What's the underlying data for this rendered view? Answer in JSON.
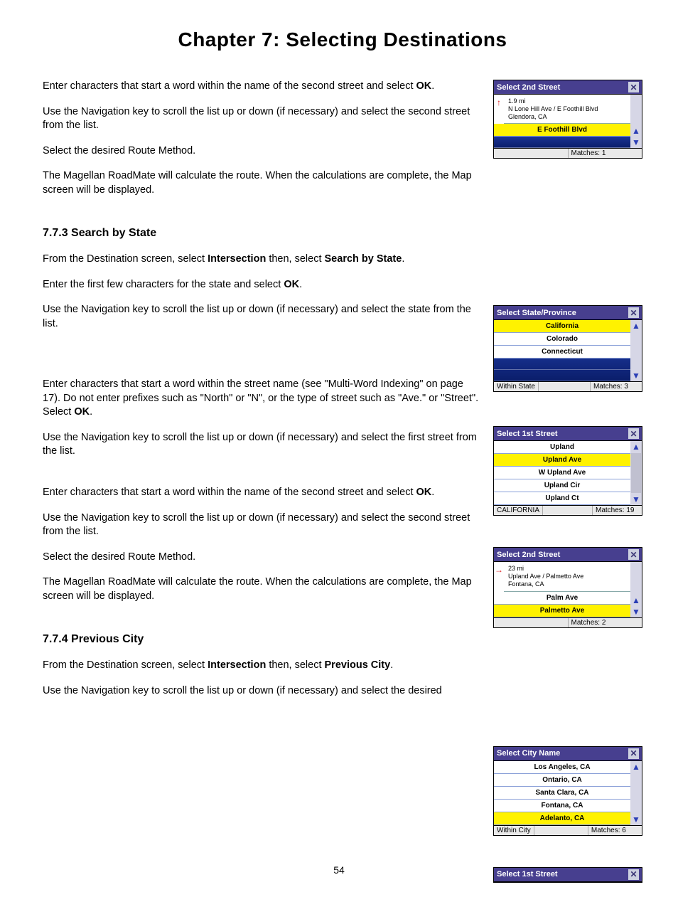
{
  "page": {
    "title": "Chapter 7: Selecting Destinations",
    "number": "54"
  },
  "text": {
    "p1a": "Enter characters that start a word within the name of the second street and select ",
    "p1b": "OK",
    "p2": "Use the Navigation key to scroll the list up or down (if necessary) and select the second street from the list.",
    "p3": "Select the desired Route Method.",
    "p4": "The Magellan RoadMate will calculate the route. When the calculations are complete, the Map screen will be displayed.",
    "h773": "7.7.3 Search by State",
    "p5a": "From the Destination screen, select ",
    "p5b": "Intersection",
    "p5c": " then, select ",
    "p5d": "Search by State",
    "p6a": "Enter the first few characters for the state and select ",
    "p6b": "OK",
    "p7": "Use the Navigation key to scroll the list up or down (if necessary) and select the state from the list.",
    "p8a": "Enter characters that start a word within the street name (see \"Multi-Word Indexing\" on page 17). Do not enter prefixes such as \"North\" or \"N\", or the type of street such as \"Ave.\" or \"Street\". Select ",
    "p8b": "OK",
    "p9": "Use the Navigation key to scroll the list up or down (if necessary) and select the first street from the list.",
    "p10a": "Enter characters that start a word within the name of the second street and select ",
    "p10b": "OK",
    "p11": "Use the Navigation key to scroll the list up or down (if necessary) and select the second street from the list.",
    "p12": "Select the desired Route Method.",
    "p13": "The Magellan RoadMate will calculate the route. When the calculations are complete, the Map screen will be displayed.",
    "h774": "7.7.4 Previous City",
    "p14a": "From the Destination screen, select ",
    "p14b": "Intersection",
    "p14c": " then, select ",
    "p14d": "Previous City",
    "p15": "Use the Navigation key to scroll the list up or down (if necessary) and select the desired"
  },
  "shots": {
    "s1": {
      "title": "Select 2nd Street",
      "dist": "1.9 mi",
      "addr1": "N Lone Hill Ave / E Foothill Blvd",
      "addr2": "Glendora, CA",
      "rowA": "E Foothill Blvd",
      "matches": "Matches:  1"
    },
    "s2": {
      "title": "Select State/Province",
      "r1": "California",
      "r2": "Colorado",
      "r3": "Connecticut",
      "left": "Within State",
      "matches": "Matches:  3"
    },
    "s3": {
      "title": "Select 1st Street",
      "r1": "Upland",
      "r2": "Upland Ave",
      "r3": "W Upland Ave",
      "r4": "Upland Cir",
      "r5": "Upland Ct",
      "left": "CALIFORNIA",
      "matches": "Matches: 19"
    },
    "s4": {
      "title": "Select 2nd Street",
      "dist": "23 mi",
      "addr1": "Upland Ave / Palmetto Ave",
      "addr2": "Fontana, CA",
      "rowA": "Palm Ave",
      "rowB": "Palmetto Ave",
      "matches": "Matches:  2"
    },
    "s5": {
      "title": "Select City Name",
      "r1": "Los Angeles, CA",
      "r2": "Ontario, CA",
      "r3": "Santa Clara, CA",
      "r4": "Fontana, CA",
      "r5": "Adelanto, CA",
      "left": "Within City",
      "matches": "Matches:  6"
    },
    "s6": {
      "title": "Select 1st Street"
    }
  }
}
